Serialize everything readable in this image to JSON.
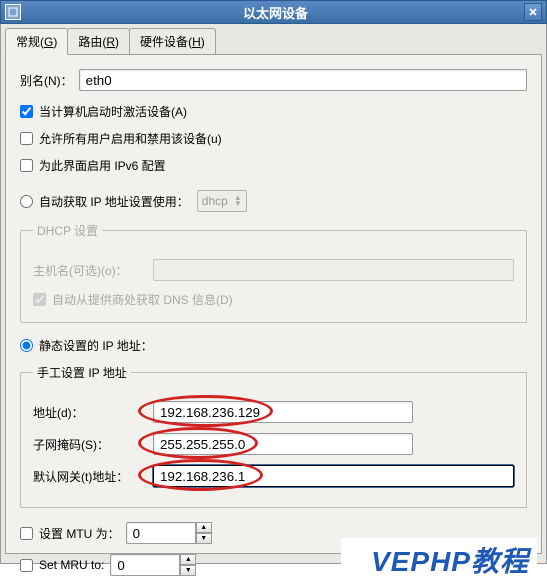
{
  "title": "以太网设备",
  "tabs": {
    "general": "常规",
    "route": "路由",
    "hardware": "硬件设备",
    "general_key": "G",
    "route_key": "R",
    "hardware_key": "H"
  },
  "alias": {
    "label": "别名(N)：",
    "value": "eth0"
  },
  "checks": {
    "activate_on_boot": "当计算机启动时激活设备(A)",
    "allow_all_users": "允许所有用户启用和禁用该设备(u)",
    "ipv6": "为此界面启用 IPv6 配置"
  },
  "auto_ip": {
    "label": "自动获取 IP 地址设置使用：",
    "combo": "dhcp"
  },
  "dhcp": {
    "legend": "DHCP 设置",
    "hostname_label": "主机名(可选)(o)：",
    "auto_dns": "自动从提供商处获取 DNS 信息(D)"
  },
  "static_ip": {
    "label": "静态设置的 IP 地址："
  },
  "manual": {
    "legend": "手工设置 IP 地址",
    "address_label": "地址(d)：",
    "address_value": "192.168.236.129",
    "netmask_label": "子网掩码(S)：",
    "netmask_value": "255.255.255.0",
    "gateway_label": "默认网关(t)地址：",
    "gateway_value": "192.168.236.1"
  },
  "mtu": {
    "label": "设置 MTU 为：",
    "value": "0"
  },
  "mru": {
    "label": "Set MRU to:",
    "value": "0"
  },
  "watermark": "VEPHP教程"
}
